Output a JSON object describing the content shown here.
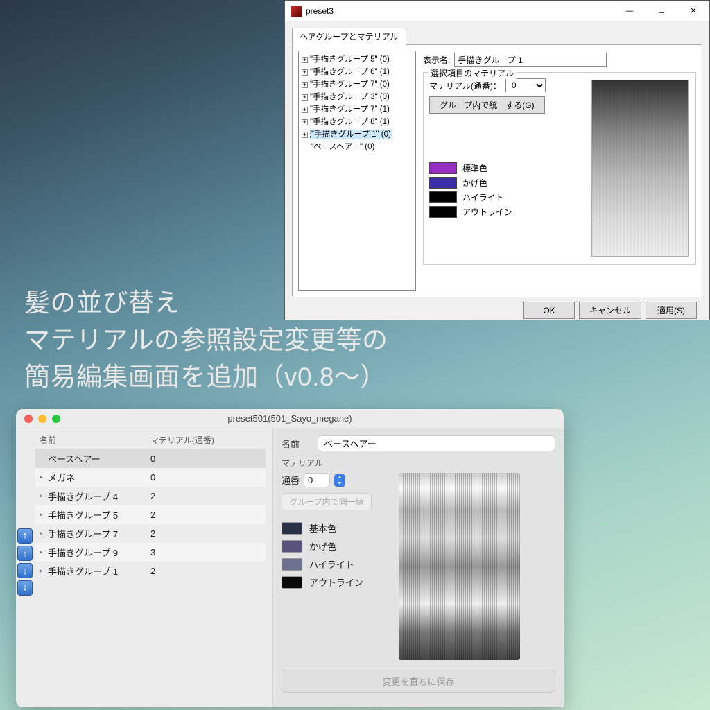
{
  "caption_line1": "髪の並び替え",
  "caption_line2": "マテリアルの参照設定変更等の",
  "caption_line3": "簡易編集画面を追加（v0.8～）",
  "win": {
    "title": "preset3",
    "tab_label": "ヘアグループとマテリアル",
    "tree": [
      {
        "label": "\"手描きグループ 5\" (0)",
        "expandable": true
      },
      {
        "label": "\"手描きグループ 6\" (1)",
        "expandable": true
      },
      {
        "label": "\"手描きグループ 7\" (0)",
        "expandable": true
      },
      {
        "label": "\"手描きグループ 3\" (0)",
        "expandable": true
      },
      {
        "label": "\"手描きグループ 7\" (1)",
        "expandable": true
      },
      {
        "label": "\"手描きグループ 8\" (1)",
        "expandable": true
      },
      {
        "label": "\"手描きグループ 1\" (0)",
        "expandable": true,
        "selected": true
      },
      {
        "label": "\"ベースヘアー\" (0)",
        "expandable": false
      }
    ],
    "display_name_label": "表示名:",
    "display_name_value": "手描きグループ 1",
    "fieldset_legend": "選択項目のマテリアル",
    "material_label": "マテリアル(通番)：",
    "material_value": "0",
    "unify_button": "グループ内で統一する(G)",
    "colors": [
      {
        "label": "標準色",
        "hex": "#9a2ec4"
      },
      {
        "label": "かげ色",
        "hex": "#3b2fa6"
      },
      {
        "label": "ハイライト",
        "hex": "#000000"
      },
      {
        "label": "アウトライン",
        "hex": "#000000"
      }
    ],
    "ok": "OK",
    "cancel": "キャンセル",
    "apply": "適用(S)"
  },
  "mac": {
    "title": "preset501(501_Sayo_megane)",
    "col1": "名前",
    "col2": "マテリアル(通番)",
    "rows": [
      {
        "name": "ベースヘアー",
        "mat": "0",
        "disc": false,
        "selected": true
      },
      {
        "name": "メガネ",
        "mat": "0",
        "disc": true
      },
      {
        "name": "手描きグループ 4",
        "mat": "2",
        "disc": true
      },
      {
        "name": "手描きグループ 5",
        "mat": "2",
        "disc": true
      },
      {
        "name": "手描きグループ 7",
        "mat": "2",
        "disc": true
      },
      {
        "name": "手描きグループ 9",
        "mat": "3",
        "disc": true
      },
      {
        "name": "手描きグループ 1",
        "mat": "2",
        "disc": true
      }
    ],
    "name_label": "名前",
    "name_value": "ベースヘアー",
    "material_section": "マテリアル",
    "serial_label": "通番",
    "serial_value": "0",
    "same_in_group": "グループ内で同一値",
    "colors": [
      {
        "label": "基本色",
        "hex": "#2b3247"
      },
      {
        "label": "かげ色",
        "hex": "#5a527e"
      },
      {
        "label": "ハイライト",
        "hex": "#6c728f"
      },
      {
        "label": "アウトライン",
        "hex": "#0a0a0a"
      }
    ],
    "save_button": "変更を直ちに保存"
  }
}
